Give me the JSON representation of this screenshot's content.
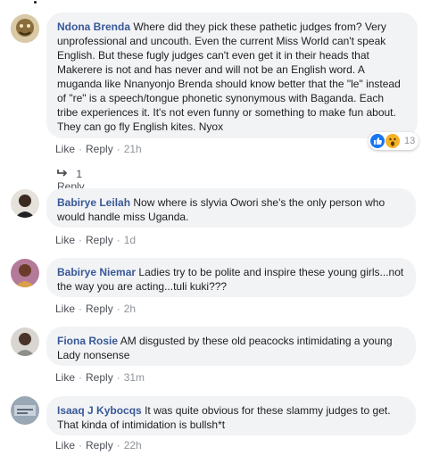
{
  "comments": [
    {
      "name": "Ndona Brenda",
      "text": "Where did they pick these pathetic judges from? Very unprofessional and uncouth. Even the current Miss World can't speak English. But these fugly judges can't even get it in their heads that Makerere is not and has never and will not be an English word. A muganda like Nnanyonjo Brenda should know better that the \"le\" instead of \"re\" is a speech/tongue phonetic synonymous with Baganda. Each tribe experiences it. It's not even funny or something to make fun about. They can go fly English kites. Nyox",
      "like": "Like",
      "reply": "Reply",
      "time": "21h",
      "reaction_count": "13",
      "reactions": [
        "like-icon",
        "wow-icon"
      ],
      "replies_label": "1 Reply"
    },
    {
      "name": "Babirye Leilah",
      "text": "Now where is slyvia Owori she's the only person who would handle miss Uganda.",
      "like": "Like",
      "reply": "Reply",
      "time": "1d"
    },
    {
      "name": "Babirye Niemar",
      "text": "Ladies try to be polite and inspire these young girls...not the way you are acting...tuli kuki???",
      "like": "Like",
      "reply": "Reply",
      "time": "2h"
    },
    {
      "name": "Fiona Rosie",
      "text": "AM disgusted by these old peacocks intimidating a young Lady nonsense",
      "like": "Like",
      "reply": "Reply",
      "time": "31m"
    },
    {
      "name": "Isaaq J Kybocqs",
      "text": "It was quite obvious for these slammy judges to get. That kinda of intimidation is bullsh*t",
      "like": "Like",
      "reply": "Reply",
      "time": "22h"
    }
  ],
  "colors": {
    "name": "#385898",
    "bubble": "#f2f3f5",
    "meta": "#90949c"
  }
}
